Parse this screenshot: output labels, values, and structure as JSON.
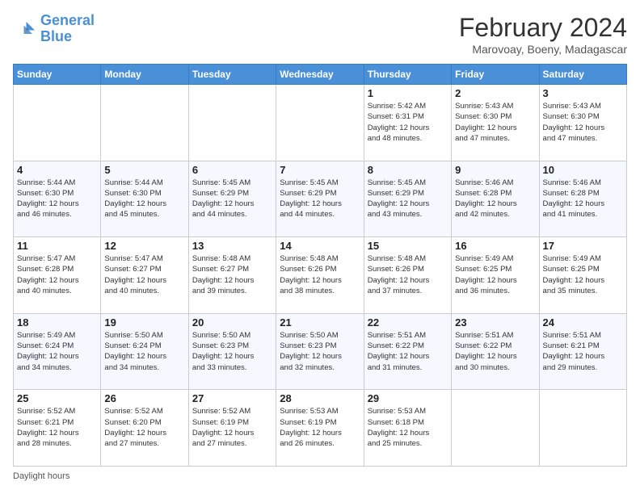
{
  "logo": {
    "line1": "General",
    "line2": "Blue"
  },
  "title": "February 2024",
  "location": "Marovoay, Boeny, Madagascar",
  "days_of_week": [
    "Sunday",
    "Monday",
    "Tuesday",
    "Wednesday",
    "Thursday",
    "Friday",
    "Saturday"
  ],
  "footer": "Daylight hours",
  "weeks": [
    [
      {
        "day": "",
        "info": ""
      },
      {
        "day": "",
        "info": ""
      },
      {
        "day": "",
        "info": ""
      },
      {
        "day": "",
        "info": ""
      },
      {
        "day": "1",
        "info": "Sunrise: 5:42 AM\nSunset: 6:31 PM\nDaylight: 12 hours\nand 48 minutes."
      },
      {
        "day": "2",
        "info": "Sunrise: 5:43 AM\nSunset: 6:30 PM\nDaylight: 12 hours\nand 47 minutes."
      },
      {
        "day": "3",
        "info": "Sunrise: 5:43 AM\nSunset: 6:30 PM\nDaylight: 12 hours\nand 47 minutes."
      }
    ],
    [
      {
        "day": "4",
        "info": "Sunrise: 5:44 AM\nSunset: 6:30 PM\nDaylight: 12 hours\nand 46 minutes."
      },
      {
        "day": "5",
        "info": "Sunrise: 5:44 AM\nSunset: 6:30 PM\nDaylight: 12 hours\nand 45 minutes."
      },
      {
        "day": "6",
        "info": "Sunrise: 5:45 AM\nSunset: 6:29 PM\nDaylight: 12 hours\nand 44 minutes."
      },
      {
        "day": "7",
        "info": "Sunrise: 5:45 AM\nSunset: 6:29 PM\nDaylight: 12 hours\nand 44 minutes."
      },
      {
        "day": "8",
        "info": "Sunrise: 5:45 AM\nSunset: 6:29 PM\nDaylight: 12 hours\nand 43 minutes."
      },
      {
        "day": "9",
        "info": "Sunrise: 5:46 AM\nSunset: 6:28 PM\nDaylight: 12 hours\nand 42 minutes."
      },
      {
        "day": "10",
        "info": "Sunrise: 5:46 AM\nSunset: 6:28 PM\nDaylight: 12 hours\nand 41 minutes."
      }
    ],
    [
      {
        "day": "11",
        "info": "Sunrise: 5:47 AM\nSunset: 6:28 PM\nDaylight: 12 hours\nand 40 minutes."
      },
      {
        "day": "12",
        "info": "Sunrise: 5:47 AM\nSunset: 6:27 PM\nDaylight: 12 hours\nand 40 minutes."
      },
      {
        "day": "13",
        "info": "Sunrise: 5:48 AM\nSunset: 6:27 PM\nDaylight: 12 hours\nand 39 minutes."
      },
      {
        "day": "14",
        "info": "Sunrise: 5:48 AM\nSunset: 6:26 PM\nDaylight: 12 hours\nand 38 minutes."
      },
      {
        "day": "15",
        "info": "Sunrise: 5:48 AM\nSunset: 6:26 PM\nDaylight: 12 hours\nand 37 minutes."
      },
      {
        "day": "16",
        "info": "Sunrise: 5:49 AM\nSunset: 6:25 PM\nDaylight: 12 hours\nand 36 minutes."
      },
      {
        "day": "17",
        "info": "Sunrise: 5:49 AM\nSunset: 6:25 PM\nDaylight: 12 hours\nand 35 minutes."
      }
    ],
    [
      {
        "day": "18",
        "info": "Sunrise: 5:49 AM\nSunset: 6:24 PM\nDaylight: 12 hours\nand 34 minutes."
      },
      {
        "day": "19",
        "info": "Sunrise: 5:50 AM\nSunset: 6:24 PM\nDaylight: 12 hours\nand 34 minutes."
      },
      {
        "day": "20",
        "info": "Sunrise: 5:50 AM\nSunset: 6:23 PM\nDaylight: 12 hours\nand 33 minutes."
      },
      {
        "day": "21",
        "info": "Sunrise: 5:50 AM\nSunset: 6:23 PM\nDaylight: 12 hours\nand 32 minutes."
      },
      {
        "day": "22",
        "info": "Sunrise: 5:51 AM\nSunset: 6:22 PM\nDaylight: 12 hours\nand 31 minutes."
      },
      {
        "day": "23",
        "info": "Sunrise: 5:51 AM\nSunset: 6:22 PM\nDaylight: 12 hours\nand 30 minutes."
      },
      {
        "day": "24",
        "info": "Sunrise: 5:51 AM\nSunset: 6:21 PM\nDaylight: 12 hours\nand 29 minutes."
      }
    ],
    [
      {
        "day": "25",
        "info": "Sunrise: 5:52 AM\nSunset: 6:21 PM\nDaylight: 12 hours\nand 28 minutes."
      },
      {
        "day": "26",
        "info": "Sunrise: 5:52 AM\nSunset: 6:20 PM\nDaylight: 12 hours\nand 27 minutes."
      },
      {
        "day": "27",
        "info": "Sunrise: 5:52 AM\nSunset: 6:19 PM\nDaylight: 12 hours\nand 27 minutes."
      },
      {
        "day": "28",
        "info": "Sunrise: 5:53 AM\nSunset: 6:19 PM\nDaylight: 12 hours\nand 26 minutes."
      },
      {
        "day": "29",
        "info": "Sunrise: 5:53 AM\nSunset: 6:18 PM\nDaylight: 12 hours\nand 25 minutes."
      },
      {
        "day": "",
        "info": ""
      },
      {
        "day": "",
        "info": ""
      }
    ]
  ]
}
